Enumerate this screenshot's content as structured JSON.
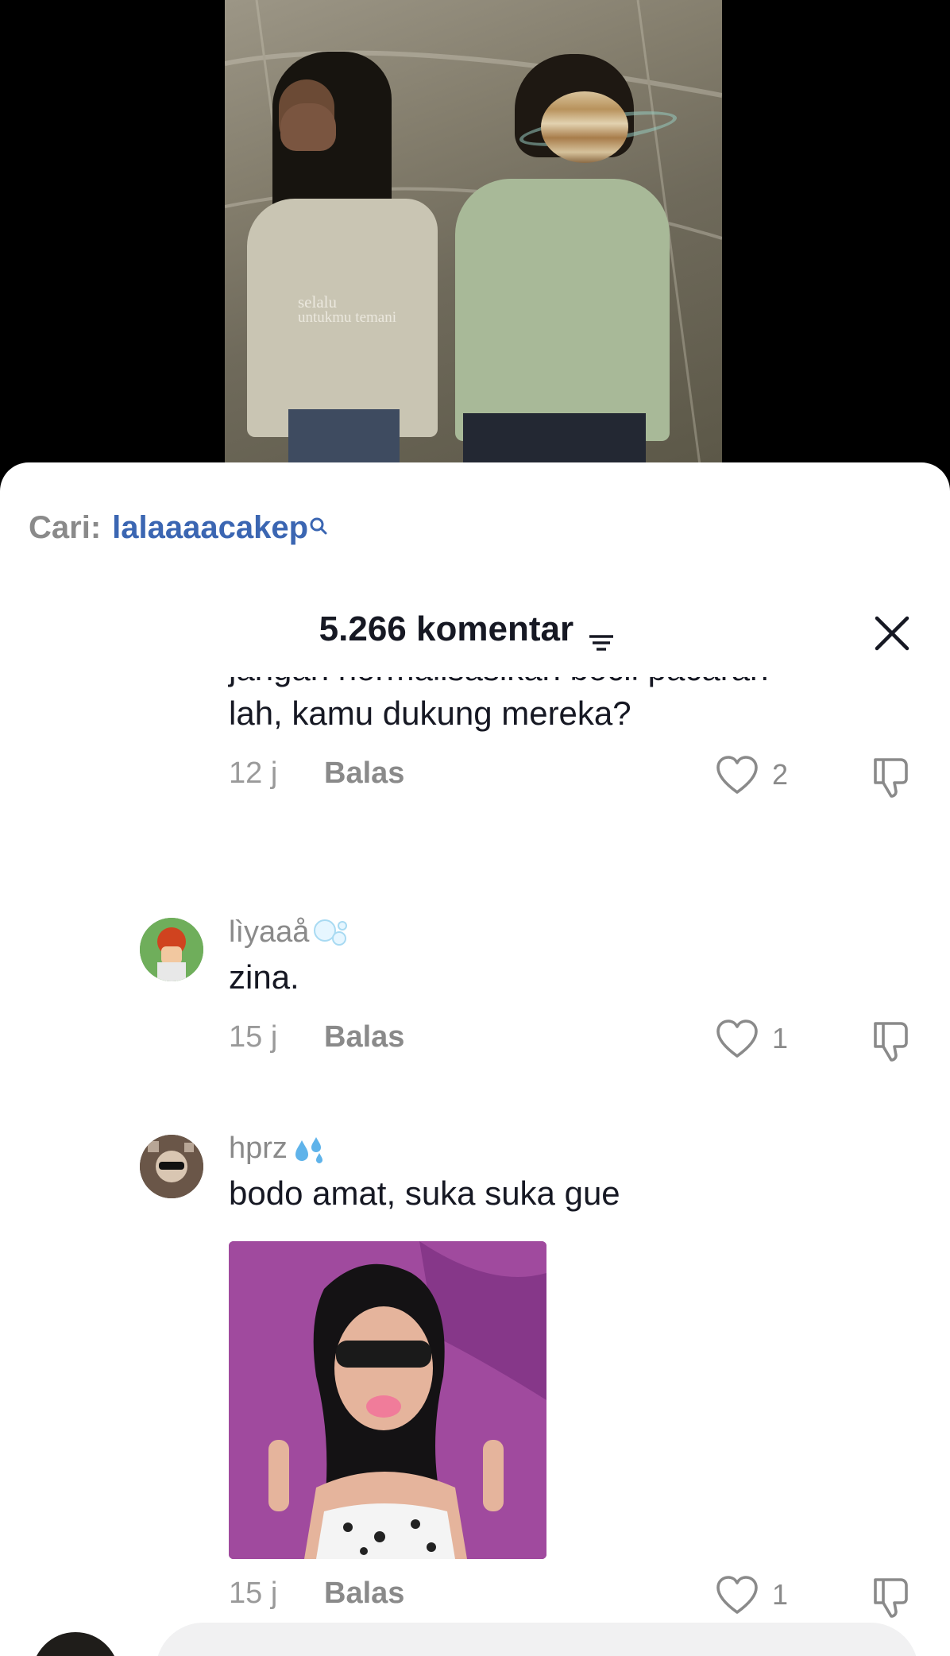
{
  "video": {
    "overlay_line1": "selalu",
    "overlay_line2": "untukmu temani"
  },
  "search": {
    "prefix": "Cari:",
    "query": "lalaaaacakep",
    "link_color": "#3b66b2"
  },
  "header": {
    "comment_count_title": "5.266 komentar",
    "filter_icon": "filter-icon",
    "close_icon": "close-icon"
  },
  "comments": [
    {
      "partial_top_line": "jangan normalisasikan bocil pacaran",
      "text": "lah, kamu dukung mereka?",
      "time": "12 j",
      "reply_label": "Balas",
      "likes": "2"
    },
    {
      "username": "lìyaaå",
      "username_emoji": "bubbles-icon",
      "text": "zina.",
      "time": "15 j",
      "reply_label": "Balas",
      "likes": "1"
    },
    {
      "username": "hprz",
      "username_emoji": "sweat-droplets-icon",
      "text": "bodo amat, suka suka gue",
      "has_sticker": true,
      "time": "15 j",
      "reply_label": "Balas",
      "likes": "1"
    }
  ],
  "colors": {
    "text_primary": "#161823",
    "text_secondary": "#8a8a8a",
    "sheet_bg": "#ffffff",
    "page_bg": "#000000"
  }
}
